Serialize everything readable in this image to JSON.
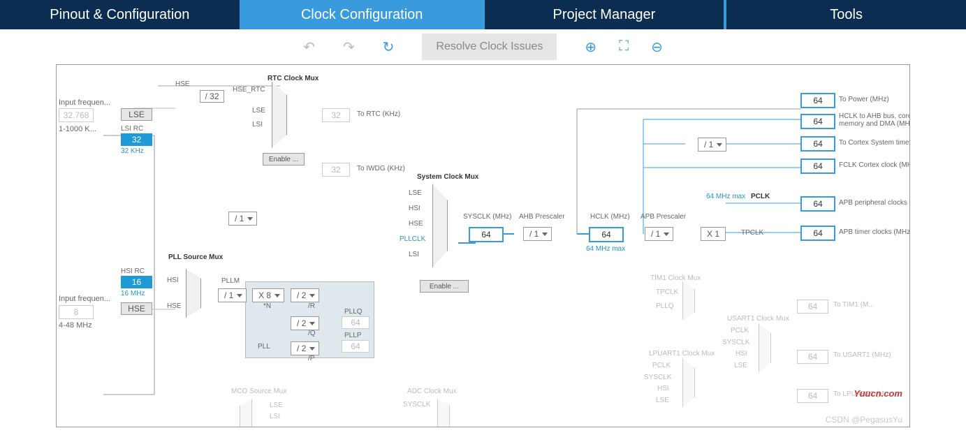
{
  "tabs": {
    "pinout": "Pinout & Configuration",
    "clock": "Clock Configuration",
    "project": "Project Manager",
    "tools": "Tools"
  },
  "toolbar": {
    "resolve": "Resolve Clock Issues"
  },
  "labels": {
    "input_freq1": "Input frequen...",
    "input_freq2": "Input frequen...",
    "range1": "1-1000 K...",
    "range2": "4-48 MHz",
    "lse": "LSE",
    "lsi_rc": "LSI RC",
    "lsi_val": "32",
    "lsi_khz": "32 KHz",
    "hsi_rc": "HSI RC",
    "hsi_val": "16",
    "hsi_mhz": "16 MHz",
    "hse_in": "HSE",
    "lse_32768": "32.768",
    "hse_8": "8",
    "hse_lbl": "HSE",
    "hse_rtc": "HSE_RTC",
    "div32": "/ 32",
    "rtc_mux": "RTC Clock Mux",
    "lse_lbl": "LSE",
    "lsi_lbl": "LSI",
    "rtc_32": "32",
    "to_rtc": "To RTC (KHz)",
    "enable_css1": "Enable ...",
    "iwdg_32": "32",
    "to_iwdg": "To IWDG (KHz)",
    "sys_mux": "System Clock Mux",
    "pll_src": "PLL Source Mux",
    "hsi_lbl": "HSI",
    "hse_lbl2": "HSE",
    "pllm": "PLLM",
    "pll_div1": "/ 1",
    "pll_x8": "X 8",
    "pll_n": "*N",
    "pll_r": "/R",
    "pll_q": "/Q",
    "pll_p": "/P",
    "pll_div2a": "/ 2",
    "pll_div2b": "/ 2",
    "pll_div2c": "/ 2",
    "pll_label": "PLL",
    "pllq": "PLLQ",
    "pllp": "PLLP",
    "pll_out_64a": "64",
    "pll_out_64b": "64",
    "pre_div1": "/ 1",
    "mux_lse": "LSE",
    "mux_hsi": "HSI",
    "mux_hse": "HSE",
    "mux_pllclk": "PLLCLK",
    "mux_lsi": "LSI",
    "enable_css2": "Enable ...",
    "sysclk_lbl": "SYSCLK (MHz)",
    "sysclk_val": "64",
    "ahb_pre": "AHB Prescaler",
    "ahb_div1": "/ 1",
    "hclk_lbl": "HCLK (MHz)",
    "hclk_val": "64",
    "hclk_max": "64 MHz max",
    "apb_pre": "APB Prescaler",
    "apb_div1": "/ 1",
    "apb_max": "64 MHz max",
    "pclk": "PCLK",
    "tpclk": "TPCLK",
    "x1": "X 1",
    "cortex_div1": "/ 1",
    "out_power": "64",
    "out_power_lbl": "To Power (MHz)",
    "out_ahb": "64",
    "out_ahb_lbl": "HCLK to AHB bus, core, memory and DMA (MHz)",
    "out_cortex": "64",
    "out_cortex_lbl": "To Cortex System timer (MHz)",
    "out_fclk": "64",
    "out_fclk_lbl": "FCLK Cortex clock (MHz)",
    "out_apb_p": "64",
    "out_apb_p_lbl": "APB peripheral clocks (MHz)",
    "out_apb_t": "64",
    "out_apb_t_lbl": "APB timer clocks (MHz)",
    "tim1_mux": "TIM1 Clock Mux",
    "tim1_tpclk": "TPCLK",
    "tim1_pllq": "PLLQ",
    "tim1_out": "64",
    "to_tim1": "To TIM1 (M...",
    "usart1_mux": "USART1 Clock Mux",
    "u_pclk": "PCLK",
    "u_sysclk": "SYSCLK",
    "u_hsi": "HSI",
    "u_lse": "LSE",
    "usart1_out": "64",
    "to_usart1": "To USART1 (MHz)",
    "lpuart1_mux": "LPUART1 Clock Mux",
    "l_pclk": "PCLK",
    "l_sysclk": "SYSCLK",
    "l_hsi": "HSI",
    "l_lse": "LSE",
    "lpuart1_out": "64",
    "to_lpuart1": "To LPUART1 (M...",
    "mco_mux": "MCO Source Mux",
    "mco_lse": "LSE",
    "mco_lsi": "LSI",
    "adc_mux": "ADC Clock Mux",
    "adc_sysclk": "SYSCLK"
  },
  "watermark": "CSDN @PegasusYu",
  "watermark2": "Yuucn.com"
}
